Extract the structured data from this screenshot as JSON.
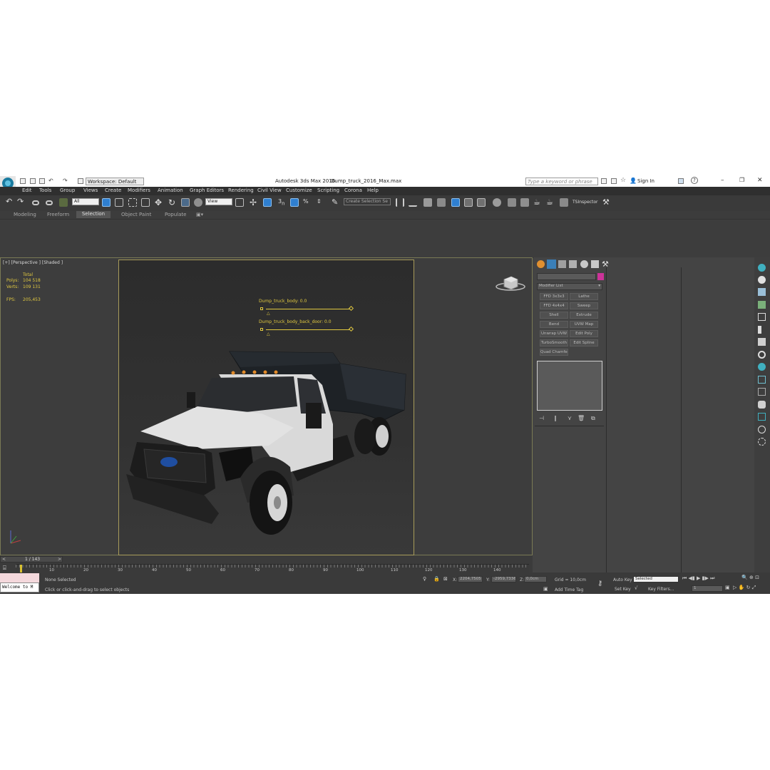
{
  "title_bar": {
    "app_title": "Autodesk 3ds Max 2016",
    "file_name": "Dump_truck_2016_Max.max",
    "workspace": "Workspace: Default",
    "search_placeholder": "Type a keyword or phrase",
    "sign_in": "Sign In"
  },
  "menu": [
    "Edit",
    "Tools",
    "Group",
    "Views",
    "Create",
    "Modifiers",
    "Animation",
    "Graph Editors",
    "Rendering",
    "Civil View",
    "Customize",
    "Scripting",
    "Corona",
    "Help"
  ],
  "toolbar": {
    "filter_value": "All",
    "ref_coord_value": "View",
    "selection_set_value": "Create Selection Se",
    "tsinspector": "TSInspector"
  },
  "ribbon_tabs": [
    "Modeling",
    "Freeform",
    "Selection",
    "Object Paint",
    "Populate"
  ],
  "viewport": {
    "label": "[+] [Perspective ] [Shaded ]",
    "stats": {
      "total_label": "Total",
      "polys_label": "Polys:",
      "polys_value": "104 518",
      "verts_label": "Verts:",
      "verts_value": "109 131",
      "fps_label": "FPS:",
      "fps_value": "205,453"
    },
    "morph_sliders": [
      {
        "label": "Dump_truck_body: 0.0",
        "value": 0.0
      },
      {
        "label": "Dump_truck_body_back_door: 0.0",
        "value": 0.0
      }
    ]
  },
  "command_panel": {
    "modifier_list": "Modifier List",
    "modifier_buttons": [
      "FFD 3x3x3",
      "Lathe",
      "FFD 4x4x4",
      "Sweep",
      "Shell",
      "Extrude",
      "Bend",
      "UVW Map",
      "Unwrap UVW",
      "Edit Poly",
      "TurboSmooth",
      "Edit Spline",
      "Quad Chamfer"
    ],
    "name_color": "#cc3399"
  },
  "timeline": {
    "frame_counter": "1 / 143",
    "ticks": [
      "10",
      "20",
      "30",
      "40",
      "50",
      "60",
      "70",
      "80",
      "90",
      "100",
      "110",
      "120",
      "130",
      "140"
    ]
  },
  "status": {
    "welcome": "Welcome to M",
    "selection": "None Selected",
    "prompt": "Click or click-and-drag to select objects",
    "x_label": "X:",
    "x_value": "2204,7505",
    "y_label": "Y:",
    "y_value": "-2959,7336",
    "z_label": "Z:",
    "z_value": "0,0cm",
    "grid": "Grid = 10,0cm",
    "add_time_tag": "Add Time Tag",
    "auto_key": "Auto Key",
    "set_key": "Set Key",
    "key_mode_value": "Selected",
    "key_filters": "Key Filters...",
    "frame_field": "1"
  },
  "colors": {
    "viewport_text": "#e0c840",
    "app_bg": "#444444",
    "accent_blue": "#2f7fd0"
  }
}
